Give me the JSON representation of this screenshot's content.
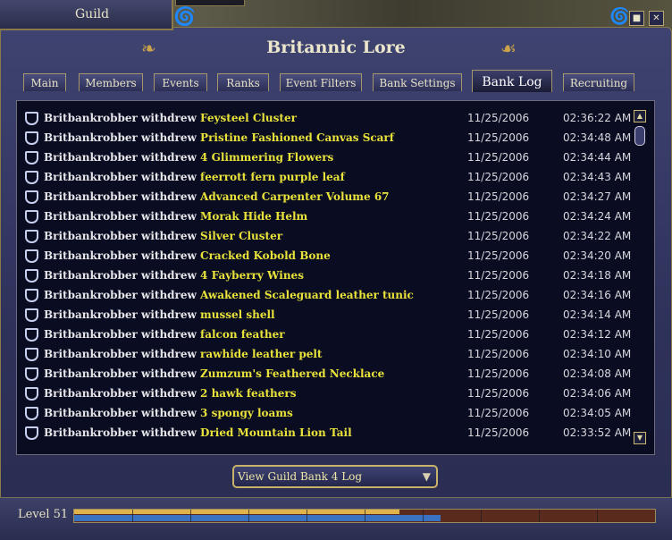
{
  "window": {
    "title": "Guild",
    "guild_name": "Britannic Lore",
    "controls": {
      "min_icon": "restore-icon",
      "close_icon": "close-icon"
    }
  },
  "tabs": [
    {
      "label": "Main"
    },
    {
      "label": "Members"
    },
    {
      "label": "Events"
    },
    {
      "label": "Ranks"
    },
    {
      "label": "Event Filters"
    },
    {
      "label": "Bank Settings"
    },
    {
      "label": "Bank Log",
      "active": true
    },
    {
      "label": "Recruiting"
    }
  ],
  "log": {
    "rows": [
      {
        "who": "Britbankrobber withdrew",
        "item": "Feysteel Cluster",
        "date": "11/25/2006",
        "time": "02:36:22 AM"
      },
      {
        "who": "Britbankrobber withdrew",
        "item": "Pristine Fashioned Canvas Scarf",
        "date": "11/25/2006",
        "time": "02:34:48 AM"
      },
      {
        "who": "Britbankrobber withdrew",
        "item": "4 Glimmering Flowers",
        "date": "11/25/2006",
        "time": "02:34:44 AM"
      },
      {
        "who": "Britbankrobber withdrew",
        "item": "feerrott fern purple leaf",
        "date": "11/25/2006",
        "time": "02:34:43 AM"
      },
      {
        "who": "Britbankrobber withdrew",
        "item": "Advanced Carpenter Volume 67",
        "date": "11/25/2006",
        "time": "02:34:27 AM"
      },
      {
        "who": "Britbankrobber withdrew",
        "item": "Morak Hide Helm",
        "date": "11/25/2006",
        "time": "02:34:24 AM"
      },
      {
        "who": "Britbankrobber withdrew",
        "item": "Silver Cluster",
        "date": "11/25/2006",
        "time": "02:34:22 AM"
      },
      {
        "who": "Britbankrobber withdrew",
        "item": "Cracked Kobold Bone",
        "date": "11/25/2006",
        "time": "02:34:20 AM"
      },
      {
        "who": "Britbankrobber withdrew",
        "item": "4 Fayberry Wines",
        "date": "11/25/2006",
        "time": "02:34:18 AM"
      },
      {
        "who": "Britbankrobber withdrew",
        "item": "Awakened Scaleguard leather tunic",
        "date": "11/25/2006",
        "time": "02:34:16 AM"
      },
      {
        "who": "Britbankrobber withdrew",
        "item": "mussel shell",
        "date": "11/25/2006",
        "time": "02:34:14 AM"
      },
      {
        "who": "Britbankrobber withdrew",
        "item": "falcon feather",
        "date": "11/25/2006",
        "time": "02:34:12 AM"
      },
      {
        "who": "Britbankrobber withdrew",
        "item": "rawhide leather pelt",
        "date": "11/25/2006",
        "time": "02:34:10 AM"
      },
      {
        "who": "Britbankrobber withdrew",
        "item": "Zumzum's Feathered Necklace",
        "date": "11/25/2006",
        "time": "02:34:08 AM"
      },
      {
        "who": "Britbankrobber withdrew",
        "item": "2 hawk feathers",
        "date": "11/25/2006",
        "time": "02:34:06 AM"
      },
      {
        "who": "Britbankrobber withdrew",
        "item": "3 spongy loams",
        "date": "11/25/2006",
        "time": "02:34:05 AM"
      },
      {
        "who": "Britbankrobber withdrew",
        "item": "Dried Mountain Lion Tail",
        "date": "11/25/2006",
        "time": "02:33:52 AM"
      }
    ],
    "row_icon": "shield-icon"
  },
  "bank_select": {
    "label": "View Guild Bank 4 Log",
    "icon": "dropdown-arrow-icon"
  },
  "level": {
    "label": "Level 51",
    "xp_fraction": 0.63,
    "vitality_fraction": 0.56
  },
  "colors": {
    "item": "#e8e23a",
    "accent_gold": "#c9a24a"
  }
}
